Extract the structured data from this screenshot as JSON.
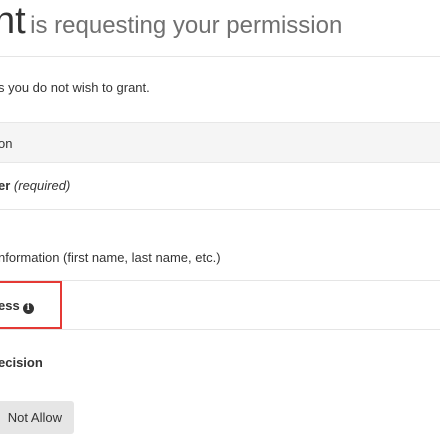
{
  "header": {
    "client_name_fragment": "nt",
    "requesting_text": "is requesting your permission"
  },
  "instructions": "s you do not wish to grant.",
  "scopes_table": {
    "header_label": "on",
    "rows": [
      {
        "label": "er",
        "note": "(required)"
      },
      {
        "label": "nformation (first name, last name, etc.)"
      },
      {
        "label": "ess",
        "icon": "info-icon",
        "highlighted": true,
        "highlight_color": "#e53935"
      },
      {
        "label": "ecision"
      }
    ]
  },
  "buttons": {
    "deny_label": "Not Allow"
  },
  "colors": {
    "highlight": "#e53935",
    "table_header_bg": "#f5f5f5",
    "button_bg": "#e6e6e6",
    "text": "#333333",
    "muted_text": "#707070"
  }
}
